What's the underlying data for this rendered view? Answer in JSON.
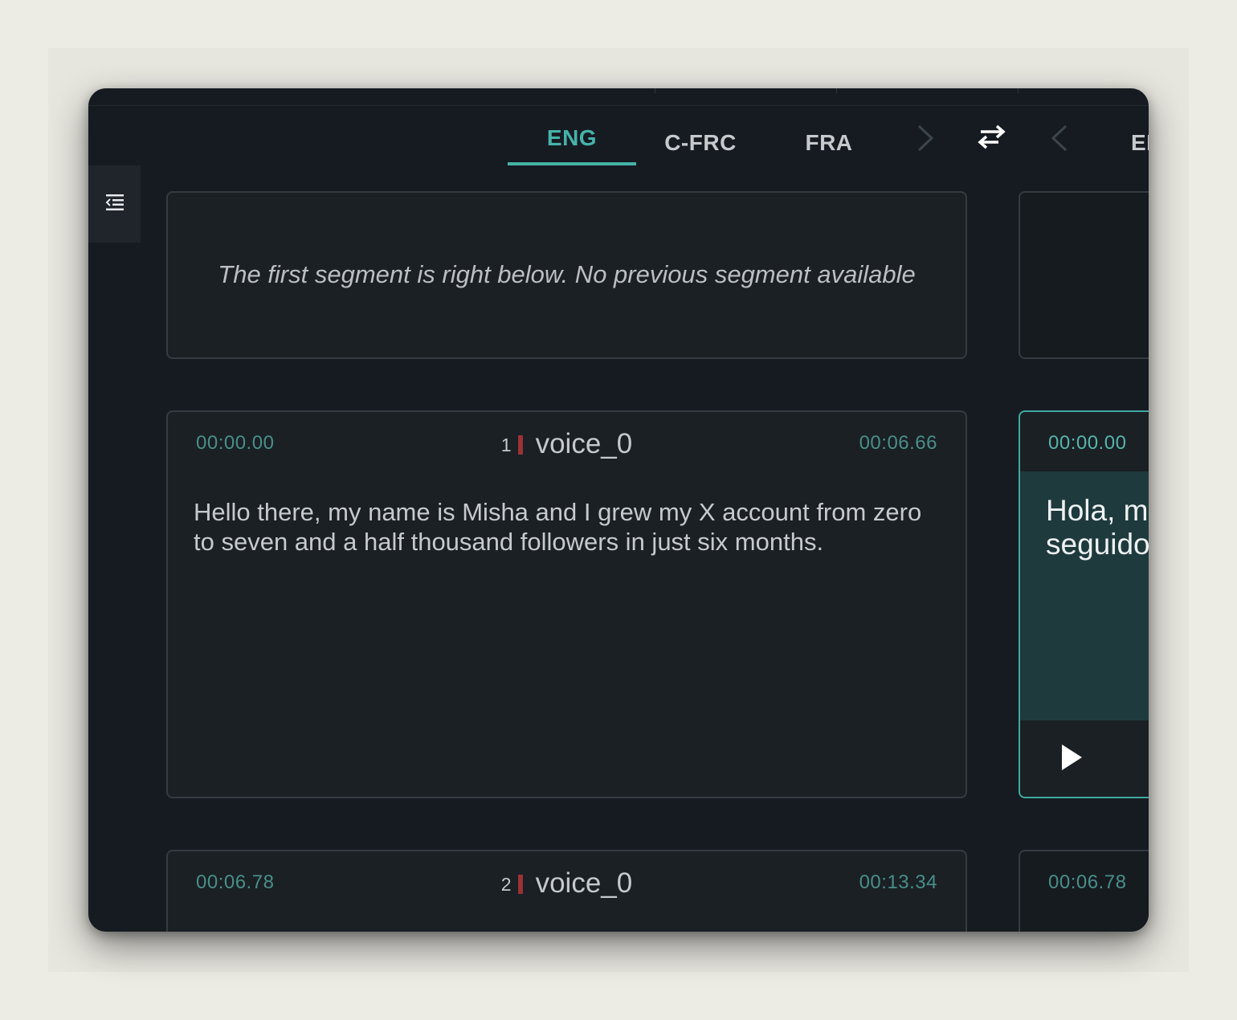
{
  "tabs": [
    {
      "label": "ENG",
      "active": true
    },
    {
      "label": "C-FRC",
      "active": false
    },
    {
      "label": "FRA",
      "active": false
    },
    {
      "label": "EN",
      "active": false
    }
  ],
  "icons": {
    "next": "chevron-right-icon",
    "swap": "swap-arrows-icon",
    "prev": "chevron-left-icon",
    "sidebar": "indent-list-icon",
    "play": "play-icon"
  },
  "colors": {
    "accent": "#46b2a8",
    "app_bg": "#161b22",
    "card_border": "#343b41",
    "speaker_bar": "#9a3236",
    "translation_bg": "#1f3a3d"
  },
  "source_column": {
    "previous_note": "The first segment is right below. No previous segment available",
    "segments": [
      {
        "index": "1",
        "speaker": "voice_0",
        "start": "00:00.00",
        "end": "00:06.66",
        "text": "Hello there, my name is Misha and I grew my X account from zero to seven and a half thousand followers in just six months."
      },
      {
        "index": "2",
        "speaker": "voice_0",
        "start": "00:06.78",
        "end": "00:13.34",
        "text": ""
      }
    ]
  },
  "target_column": {
    "segments": [
      {
        "start": "00:00.00",
        "text_line1": "Hola, m",
        "text_line2": "seguido"
      },
      {
        "start": "00:06.78"
      }
    ]
  }
}
